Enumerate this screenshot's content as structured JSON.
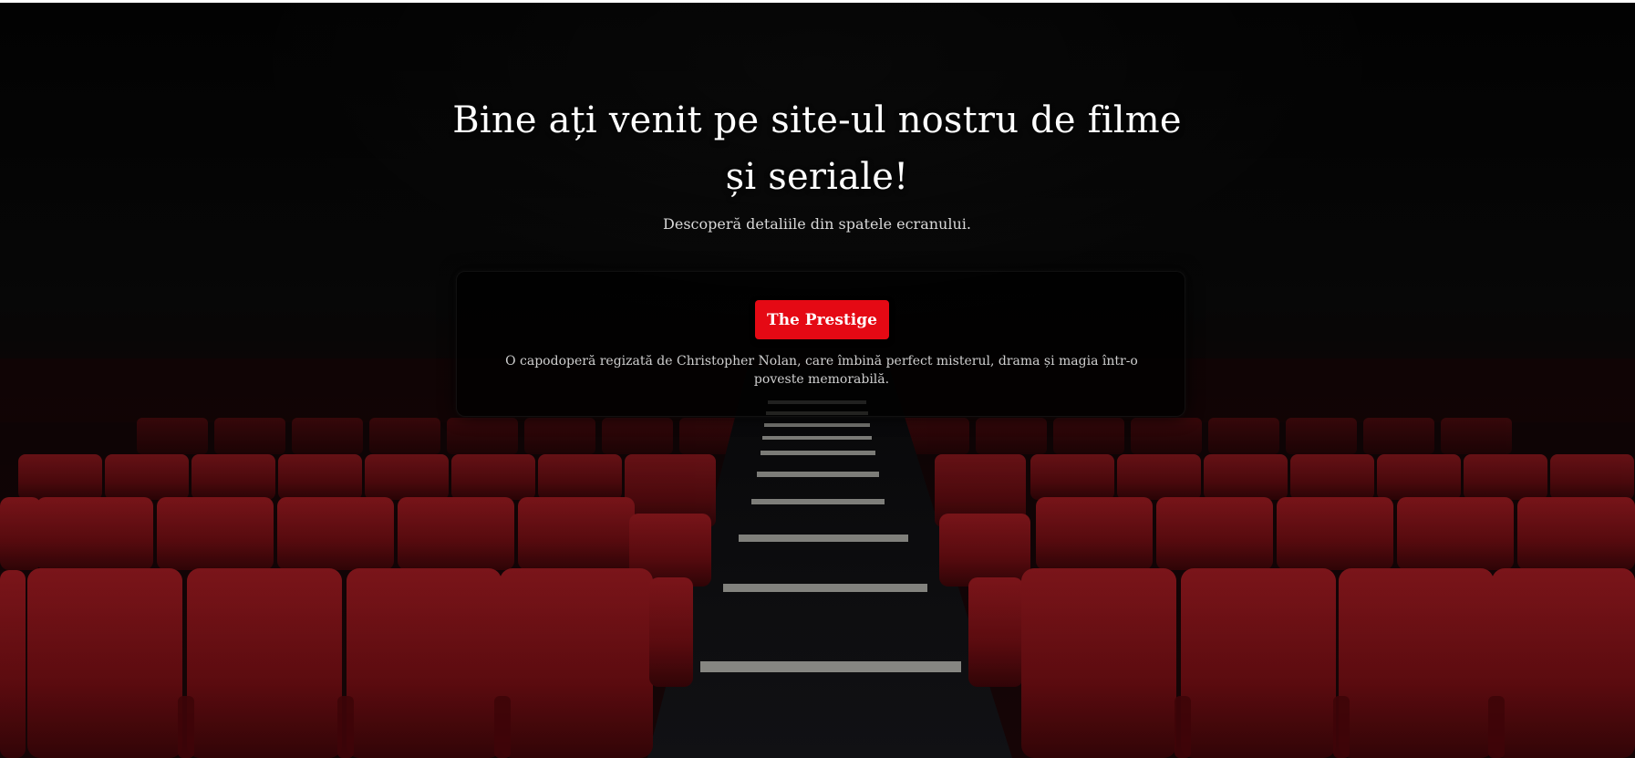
{
  "hero": {
    "title_line1": "Bine ați venit pe site-ul nostru de filme",
    "title_line2": "și seriale!",
    "subtitle": "Descoperă detaliile din spatele ecranului."
  },
  "featured": {
    "button_label": "The Prestige",
    "description": "O capodoperă regizată de Christopher Nolan, care îmbină perfect misterul, drama și magia într-o poveste memorabilă."
  },
  "colors": {
    "accent": "#e50914",
    "seat": "#7a0f14",
    "background": "#050505"
  }
}
